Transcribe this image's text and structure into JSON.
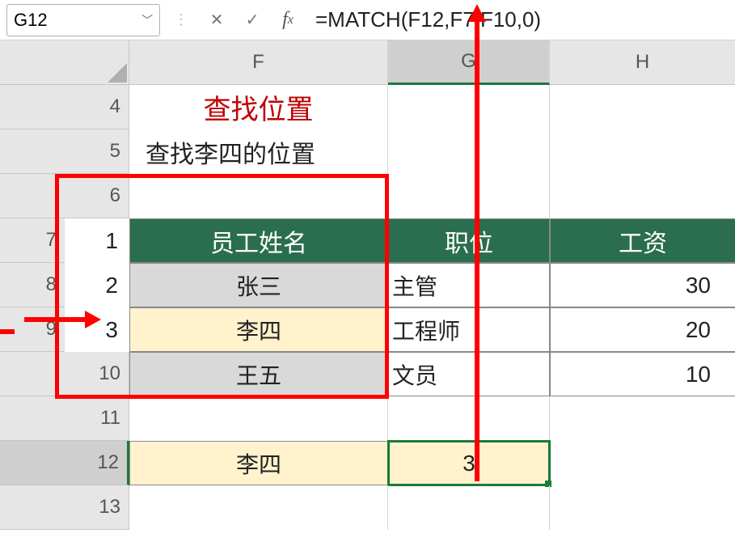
{
  "formula_bar": {
    "cell_ref": "G12",
    "formula": "=MATCH(F12,F7:F10,0)"
  },
  "columns": {
    "F": "F",
    "G": "G",
    "H": "H"
  },
  "row_headers": {
    "r4": "4",
    "r5": "5",
    "r6": "6",
    "r7": "7",
    "r8": "8",
    "r9": "9",
    "r10": "10",
    "r11": "11",
    "r12": "12",
    "r13": "13"
  },
  "aux_numbers": {
    "n7": "1",
    "n8": "2",
    "n9": "3"
  },
  "title": "查找位置",
  "subtitle": "查找李四的位置",
  "table": {
    "headers": {
      "name": "员工姓名",
      "position": "职位",
      "salary": "工资"
    },
    "rows": [
      {
        "name": "张三",
        "position": "主管",
        "salary": "30"
      },
      {
        "name": "李四",
        "position": "工程师",
        "salary": "20"
      },
      {
        "name": "王五",
        "position": "文员",
        "salary": "10"
      }
    ]
  },
  "lookup": {
    "name": "李四",
    "result": "3"
  }
}
